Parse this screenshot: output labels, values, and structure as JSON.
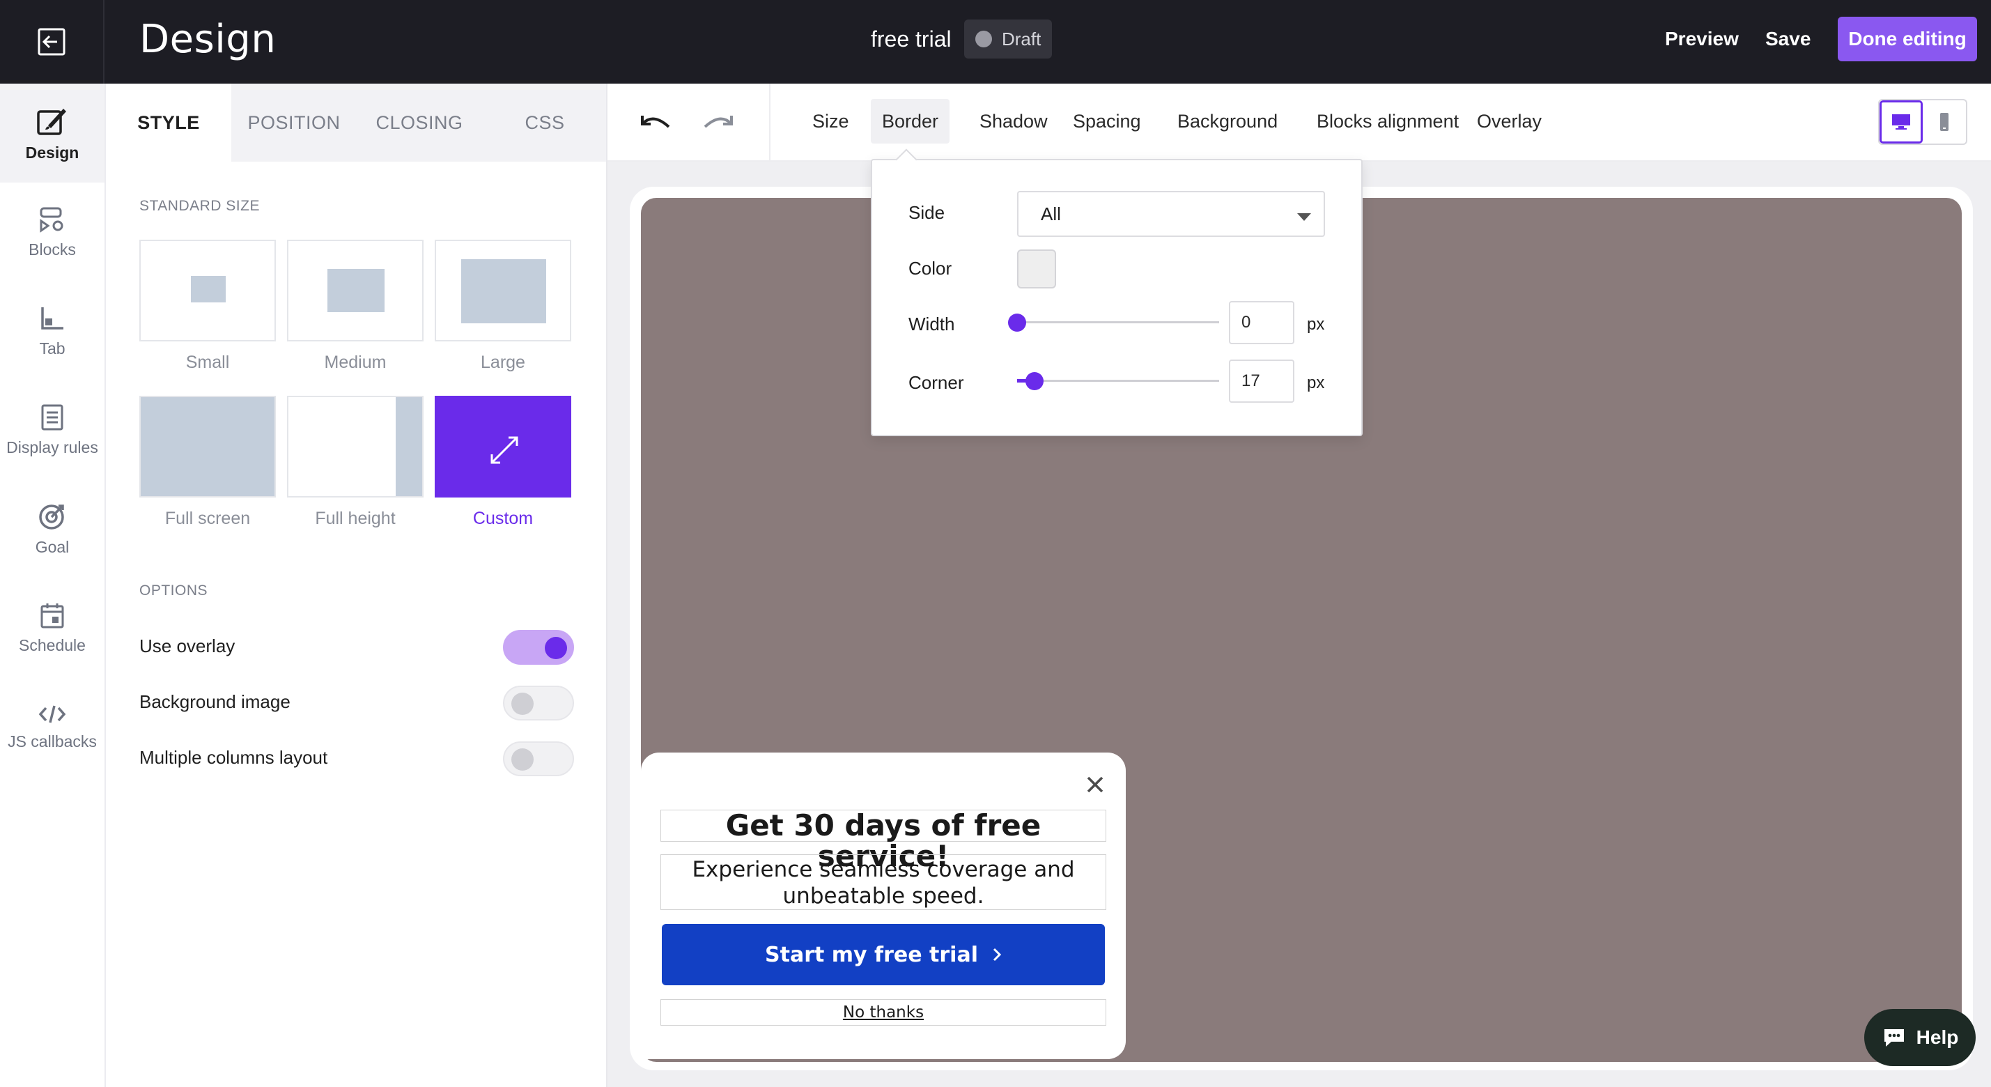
{
  "header": {
    "app_title": "Design",
    "campaign_name": "free trial",
    "status": "Draft",
    "preview_label": "Preview",
    "save_label": "Save",
    "done_label": "Done editing"
  },
  "sidebar": {
    "items": [
      {
        "label": "Design",
        "icon": "design-icon",
        "active": true
      },
      {
        "label": "Blocks",
        "icon": "blocks-icon"
      },
      {
        "label": "Tab",
        "icon": "tab-icon"
      },
      {
        "label": "Display rules",
        "icon": "display-rules-icon"
      },
      {
        "label": "Goal",
        "icon": "goal-icon"
      },
      {
        "label": "Schedule",
        "icon": "schedule-icon"
      },
      {
        "label": "JS callbacks",
        "icon": "code-icon"
      }
    ]
  },
  "panel": {
    "tabs": [
      {
        "label": "STYLE",
        "active": true
      },
      {
        "label": "POSITION"
      },
      {
        "label": "CLOSING"
      },
      {
        "label": "CSS"
      }
    ],
    "standard_size_title": "STANDARD SIZE",
    "sizes": [
      {
        "label": "Small"
      },
      {
        "label": "Medium"
      },
      {
        "label": "Large"
      },
      {
        "label": "Full screen"
      },
      {
        "label": "Full height"
      },
      {
        "label": "Custom",
        "selected": true
      }
    ],
    "options_title": "OPTIONS",
    "options": [
      {
        "label": "Use overlay",
        "on": true
      },
      {
        "label": "Background image",
        "on": false
      },
      {
        "label": "Multiple columns layout",
        "on": false
      }
    ]
  },
  "toolbar": {
    "items": [
      {
        "label": "Size"
      },
      {
        "label": "Border",
        "active": true
      },
      {
        "label": "Shadow"
      },
      {
        "label": "Spacing"
      },
      {
        "label": "Background"
      },
      {
        "label": "Blocks alignment"
      },
      {
        "label": "Overlay"
      }
    ],
    "device_selected": "desktop"
  },
  "border_panel": {
    "side_label": "Side",
    "side_value": "All",
    "color_label": "Color",
    "color_value": "#eeeeee",
    "width_label": "Width",
    "width_value": "0",
    "width_unit": "px",
    "corner_label": "Corner",
    "corner_value": "17",
    "corner_unit": "px"
  },
  "popup": {
    "title": "Get 30 days of free service!",
    "subtitle": "Experience seamless coverage and unbeatable speed.",
    "cta_label": "Start my free trial",
    "dismiss_label": "No thanks"
  },
  "help": {
    "label": "Help"
  },
  "colors": {
    "accent": "#6a2bea",
    "done_button": "#8a58f0",
    "cta": "#1240c4",
    "overlay": "#8a7b7b",
    "topbar": "#1d1d24"
  }
}
